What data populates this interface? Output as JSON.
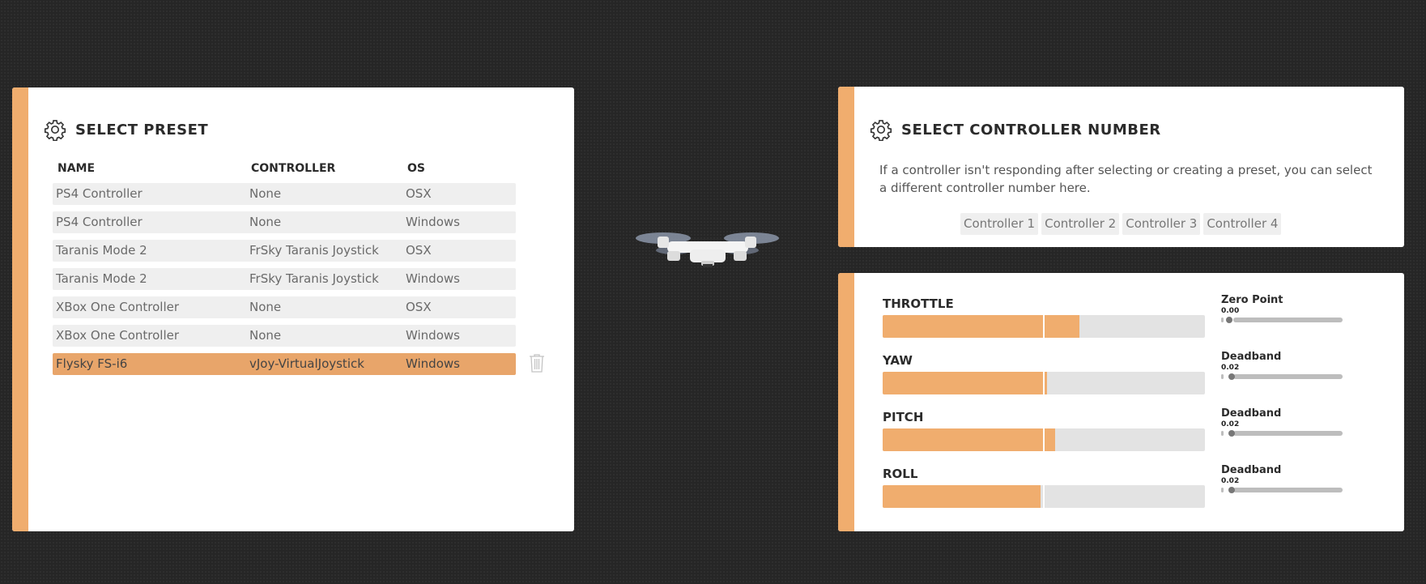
{
  "preset": {
    "title": "SELECT PRESET",
    "columns": {
      "name": "NAME",
      "controller": "CONTROLLER",
      "os": "OS"
    },
    "rows": [
      {
        "name": "PS4 Controller",
        "controller": "None",
        "os": "OSX"
      },
      {
        "name": "PS4 Controller",
        "controller": "None",
        "os": "Windows"
      },
      {
        "name": "Taranis Mode 2",
        "controller": "FrSky Taranis Joystick",
        "os": "OSX"
      },
      {
        "name": "Taranis Mode 2",
        "controller": "FrSky Taranis Joystick",
        "os": "Windows"
      },
      {
        "name": "XBox One Controller",
        "controller": "None",
        "os": "OSX"
      },
      {
        "name": "XBox One Controller",
        "controller": "None",
        "os": "Windows"
      },
      {
        "name": "Flysky FS-i6",
        "controller": "vJoy-VirtualJoystick",
        "os": "Windows",
        "selected": true
      }
    ],
    "delete_icon": "trash-icon"
  },
  "controller_number": {
    "title": "SELECT CONTROLLER NUMBER",
    "description": "If a controller isn't responding after selecting or creating a preset, you can select a different controller number here.",
    "buttons": [
      "Controller 1",
      "Controller 2",
      "Controller 3",
      "Controller 4"
    ]
  },
  "axes": [
    {
      "label": "THROTTLE",
      "fill": 0.61,
      "setting_label": "Zero Point",
      "setting_value": "0.00",
      "setting_level": 0.0
    },
    {
      "label": "YAW",
      "fill": 0.51,
      "setting_label": "Deadband",
      "setting_value": "0.02",
      "setting_level": 0.02
    },
    {
      "label": "PITCH",
      "fill": 0.535,
      "setting_label": "Deadband",
      "setting_value": "0.02",
      "setting_level": 0.02
    },
    {
      "label": "ROLL",
      "fill": 0.49,
      "setting_label": "Deadband",
      "setting_value": "0.02",
      "setting_level": 0.02
    }
  ],
  "colors": {
    "accent": "#f0ad6e",
    "selected_row": "#e8a56a",
    "background": "#262626"
  },
  "icons": {
    "settings": "gear-icon",
    "drone": "drone-icon"
  }
}
